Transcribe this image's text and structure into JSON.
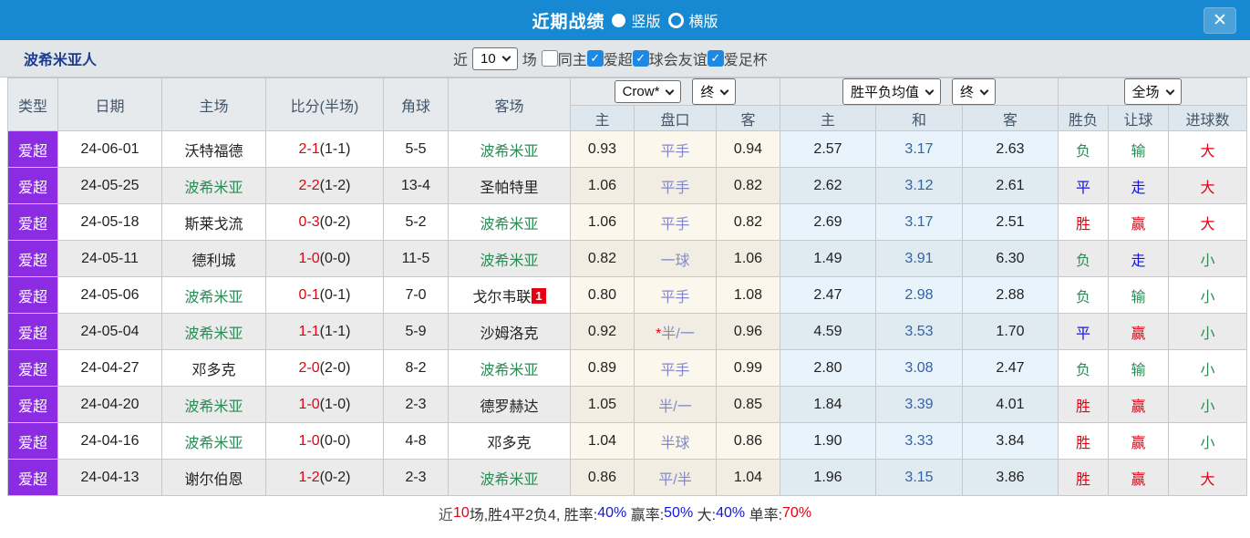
{
  "titlebar": {
    "title": "近期战绩",
    "radio_vertical": "竖版",
    "radio_horizontal": "横版",
    "vertical_selected": true,
    "close_glyph": "✕"
  },
  "filters": {
    "team": "波希米亚人",
    "recent_label": "近",
    "recent_value": "10",
    "matches_label": "场",
    "checkboxes": [
      {
        "label": "同主",
        "checked": false
      },
      {
        "label": "爱超",
        "checked": true
      },
      {
        "label": "球会友谊",
        "checked": true
      },
      {
        "label": "爱足杯",
        "checked": true
      }
    ],
    "check_glyph": "✓"
  },
  "table": {
    "main_columns": [
      "类型",
      "日期",
      "主场",
      "比分(半场)",
      "角球",
      "客场"
    ],
    "asian": {
      "book": "Crow*",
      "stage": "终",
      "sub": [
        "主",
        "盘口",
        "客"
      ]
    },
    "euro": {
      "book": "胜平负均值",
      "stage": "终",
      "sub": [
        "主",
        "和",
        "客"
      ]
    },
    "result": {
      "scope": "全场",
      "sub": [
        "胜负",
        "让球",
        "进球数"
      ]
    },
    "rows": [
      {
        "type": "爱超",
        "date": "24-06-01",
        "home": "沃特福德",
        "home_is_team": false,
        "score": "2-1",
        "half": "(1-1)",
        "corner": "5-5",
        "away": "波希米亚",
        "away_is_team": true,
        "away_badge": null,
        "ah": "0.93",
        "hcap": "平手",
        "hcap_star": false,
        "aa": "0.94",
        "eh": "2.57",
        "ed": "3.17",
        "ea": "2.63",
        "res": "负",
        "hres": "输",
        "goals": "大"
      },
      {
        "type": "爱超",
        "date": "24-05-25",
        "home": "波希米亚",
        "home_is_team": true,
        "score": "2-2",
        "half": "(1-2)",
        "corner": "13-4",
        "away": "圣帕特里",
        "away_is_team": false,
        "away_badge": null,
        "ah": "1.06",
        "hcap": "平手",
        "hcap_star": false,
        "aa": "0.82",
        "eh": "2.62",
        "ed": "3.12",
        "ea": "2.61",
        "res": "平",
        "hres": "走",
        "goals": "大"
      },
      {
        "type": "爱超",
        "date": "24-05-18",
        "home": "斯莱戈流",
        "home_is_team": false,
        "score": "0-3",
        "half": "(0-2)",
        "corner": "5-2",
        "away": "波希米亚",
        "away_is_team": true,
        "away_badge": null,
        "ah": "1.06",
        "hcap": "平手",
        "hcap_star": false,
        "aa": "0.82",
        "eh": "2.69",
        "ed": "3.17",
        "ea": "2.51",
        "res": "胜",
        "hres": "赢",
        "goals": "大"
      },
      {
        "type": "爱超",
        "date": "24-05-11",
        "home": "德利城",
        "home_is_team": false,
        "score": "1-0",
        "half": "(0-0)",
        "corner": "11-5",
        "away": "波希米亚",
        "away_is_team": true,
        "away_badge": null,
        "ah": "0.82",
        "hcap": "一球",
        "hcap_star": false,
        "aa": "1.06",
        "eh": "1.49",
        "ed": "3.91",
        "ea": "6.30",
        "res": "负",
        "hres": "走",
        "goals": "小"
      },
      {
        "type": "爱超",
        "date": "24-05-06",
        "home": "波希米亚",
        "home_is_team": true,
        "score": "0-1",
        "half": "(0-1)",
        "corner": "7-0",
        "away": "戈尔韦联",
        "away_is_team": false,
        "away_badge": "1",
        "ah": "0.80",
        "hcap": "平手",
        "hcap_star": false,
        "aa": "1.08",
        "eh": "2.47",
        "ed": "2.98",
        "ea": "2.88",
        "res": "负",
        "hres": "输",
        "goals": "小"
      },
      {
        "type": "爱超",
        "date": "24-05-04",
        "home": "波希米亚",
        "home_is_team": true,
        "score": "1-1",
        "half": "(1-1)",
        "corner": "5-9",
        "away": "沙姆洛克",
        "away_is_team": false,
        "away_badge": null,
        "ah": "0.92",
        "hcap": "半/一",
        "hcap_star": true,
        "aa": "0.96",
        "eh": "4.59",
        "ed": "3.53",
        "ea": "1.70",
        "res": "平",
        "hres": "赢",
        "goals": "小"
      },
      {
        "type": "爱超",
        "date": "24-04-27",
        "home": "邓多克",
        "home_is_team": false,
        "score": "2-0",
        "half": "(2-0)",
        "corner": "8-2",
        "away": "波希米亚",
        "away_is_team": true,
        "away_badge": null,
        "ah": "0.89",
        "hcap": "平手",
        "hcap_star": false,
        "aa": "0.99",
        "eh": "2.80",
        "ed": "3.08",
        "ea": "2.47",
        "res": "负",
        "hres": "输",
        "goals": "小"
      },
      {
        "type": "爱超",
        "date": "24-04-20",
        "home": "波希米亚",
        "home_is_team": true,
        "score": "1-0",
        "half": "(1-0)",
        "corner": "2-3",
        "away": "德罗赫达",
        "away_is_team": false,
        "away_badge": null,
        "ah": "1.05",
        "hcap": "半/一",
        "hcap_star": false,
        "aa": "0.85",
        "eh": "1.84",
        "ed": "3.39",
        "ea": "4.01",
        "res": "胜",
        "hres": "赢",
        "goals": "小"
      },
      {
        "type": "爱超",
        "date": "24-04-16",
        "home": "波希米亚",
        "home_is_team": true,
        "score": "1-0",
        "half": "(0-0)",
        "corner": "4-8",
        "away": "邓多克",
        "away_is_team": false,
        "away_badge": null,
        "ah": "1.04",
        "hcap": "半球",
        "hcap_star": false,
        "aa": "0.86",
        "eh": "1.90",
        "ed": "3.33",
        "ea": "3.84",
        "res": "胜",
        "hres": "赢",
        "goals": "小"
      },
      {
        "type": "爱超",
        "date": "24-04-13",
        "home": "谢尔伯恩",
        "home_is_team": false,
        "score": "1-2",
        "half": "(0-2)",
        "corner": "2-3",
        "away": "波希米亚",
        "away_is_team": true,
        "away_badge": null,
        "ah": "0.86",
        "hcap": "平/半",
        "hcap_star": false,
        "aa": "1.04",
        "eh": "1.96",
        "ed": "3.15",
        "ea": "3.86",
        "res": "胜",
        "hres": "赢",
        "goals": "大"
      }
    ]
  },
  "summary": {
    "segments": [
      {
        "text": "近",
        "color": "#555555"
      },
      {
        "text": "10",
        "color": "#e60012"
      },
      {
        "text": "场,胜4平2负4, 胜率:",
        "color": "#333333"
      },
      {
        "text": "40%",
        "color": "#1414e6"
      },
      {
        "text": " 赢率:",
        "color": "#333333"
      },
      {
        "text": "50%",
        "color": "#1414e6"
      },
      {
        "text": " 大:",
        "color": "#333333"
      },
      {
        "text": "40%",
        "color": "#1414e6"
      },
      {
        "text": " 单率:",
        "color": "#333333"
      },
      {
        "text": "70%",
        "color": "#e60012"
      }
    ]
  },
  "colors": {
    "topbar": "#1689d2",
    "league_badge": "#8b2be2",
    "team_highlight": "#2e8b57",
    "result_map": {
      "胜": "#e60012",
      "平": "#1414e6",
      "负": "#2e8b57",
      "赢": "#e60012",
      "走": "#1414e6",
      "输": "#2e8b57",
      "大": "#e60012",
      "小": "#2e8b57"
    }
  }
}
